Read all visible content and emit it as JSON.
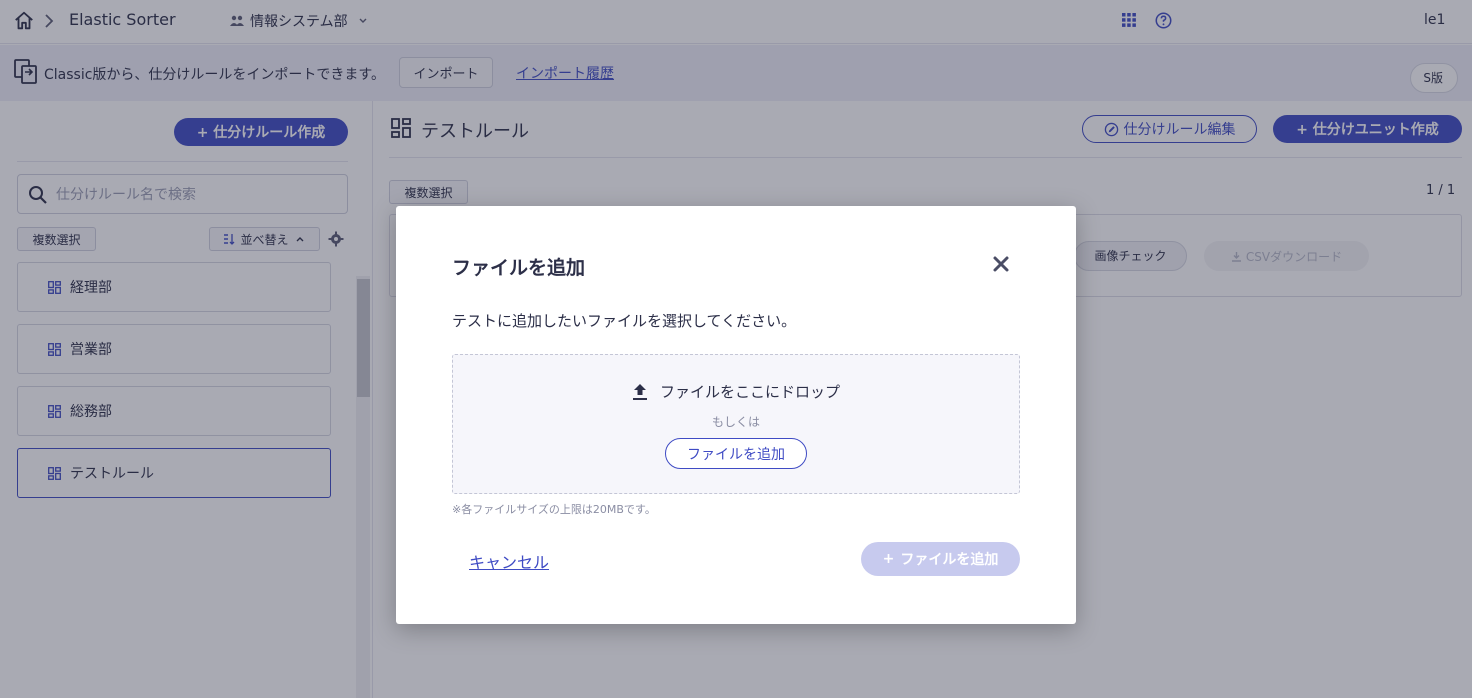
{
  "topbar": {
    "app_title": "Elastic Sorter",
    "department": "情報システム部",
    "user_name": "le1"
  },
  "banner": {
    "text": "Classic版から、仕分けルールをインポートできます。",
    "import_button": "インポート",
    "import_history_link": "インポート履歴",
    "version_label": "S版"
  },
  "sidebar": {
    "create_rule_button": "+ 仕分けルール作成",
    "search_placeholder": "仕分けルール名で検索",
    "multi_select_button": "複数選択",
    "sort_button": "並べ替え",
    "rules": [
      {
        "label": "経理部",
        "selected": false
      },
      {
        "label": "営業部",
        "selected": false
      },
      {
        "label": "総務部",
        "selected": false
      },
      {
        "label": "テストルール",
        "selected": true
      }
    ]
  },
  "main": {
    "title": "テストルール",
    "edit_rule_button": "仕分けルール編集",
    "create_unit_button": "+ 仕分けユニット作成",
    "multi_select_button": "複数選択",
    "page_count": "1 / 1",
    "image_check_button": "画像チェック",
    "csv_download_button": "CSVダウンロード"
  },
  "modal": {
    "title": "ファイルを追加",
    "description": "テストに追加したいファイルを選択してください。",
    "drop_text": "ファイルをここにドロップ",
    "or_text": "もしくは",
    "add_file_button": "ファイルを追加",
    "size_note": "※各ファイルサイズの上限は20MBです。",
    "cancel_link": "キャンセル",
    "submit_button": "ファイルを追加"
  },
  "colors": {
    "accent": "#3f4bc4",
    "disabled_accent": "#c7caee",
    "text": "#2c2f48"
  }
}
